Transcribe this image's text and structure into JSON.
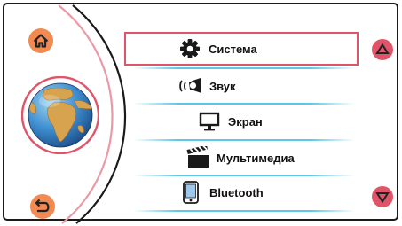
{
  "menu": {
    "items": [
      {
        "label": "Система",
        "icon": "gear-icon"
      },
      {
        "label": "Звук",
        "icon": "speaker-icon"
      },
      {
        "label": "Экран",
        "icon": "monitor-icon"
      },
      {
        "label": "Мультимедиа",
        "icon": "clapperboard-icon"
      },
      {
        "label": "Bluetooth",
        "icon": "phone-icon"
      }
    ],
    "selected_index": 0
  },
  "icons": {
    "home": "home-icon",
    "back": "back-arrow-icon",
    "scroll_up": "triangle-up-icon",
    "scroll_down": "triangle-down-icon",
    "globe": "globe-icon"
  },
  "colors": {
    "accent": "#e0546a",
    "button_orange": "#f28a52",
    "separator": "#5dc8e6",
    "frame": "#1a1a1a"
  }
}
